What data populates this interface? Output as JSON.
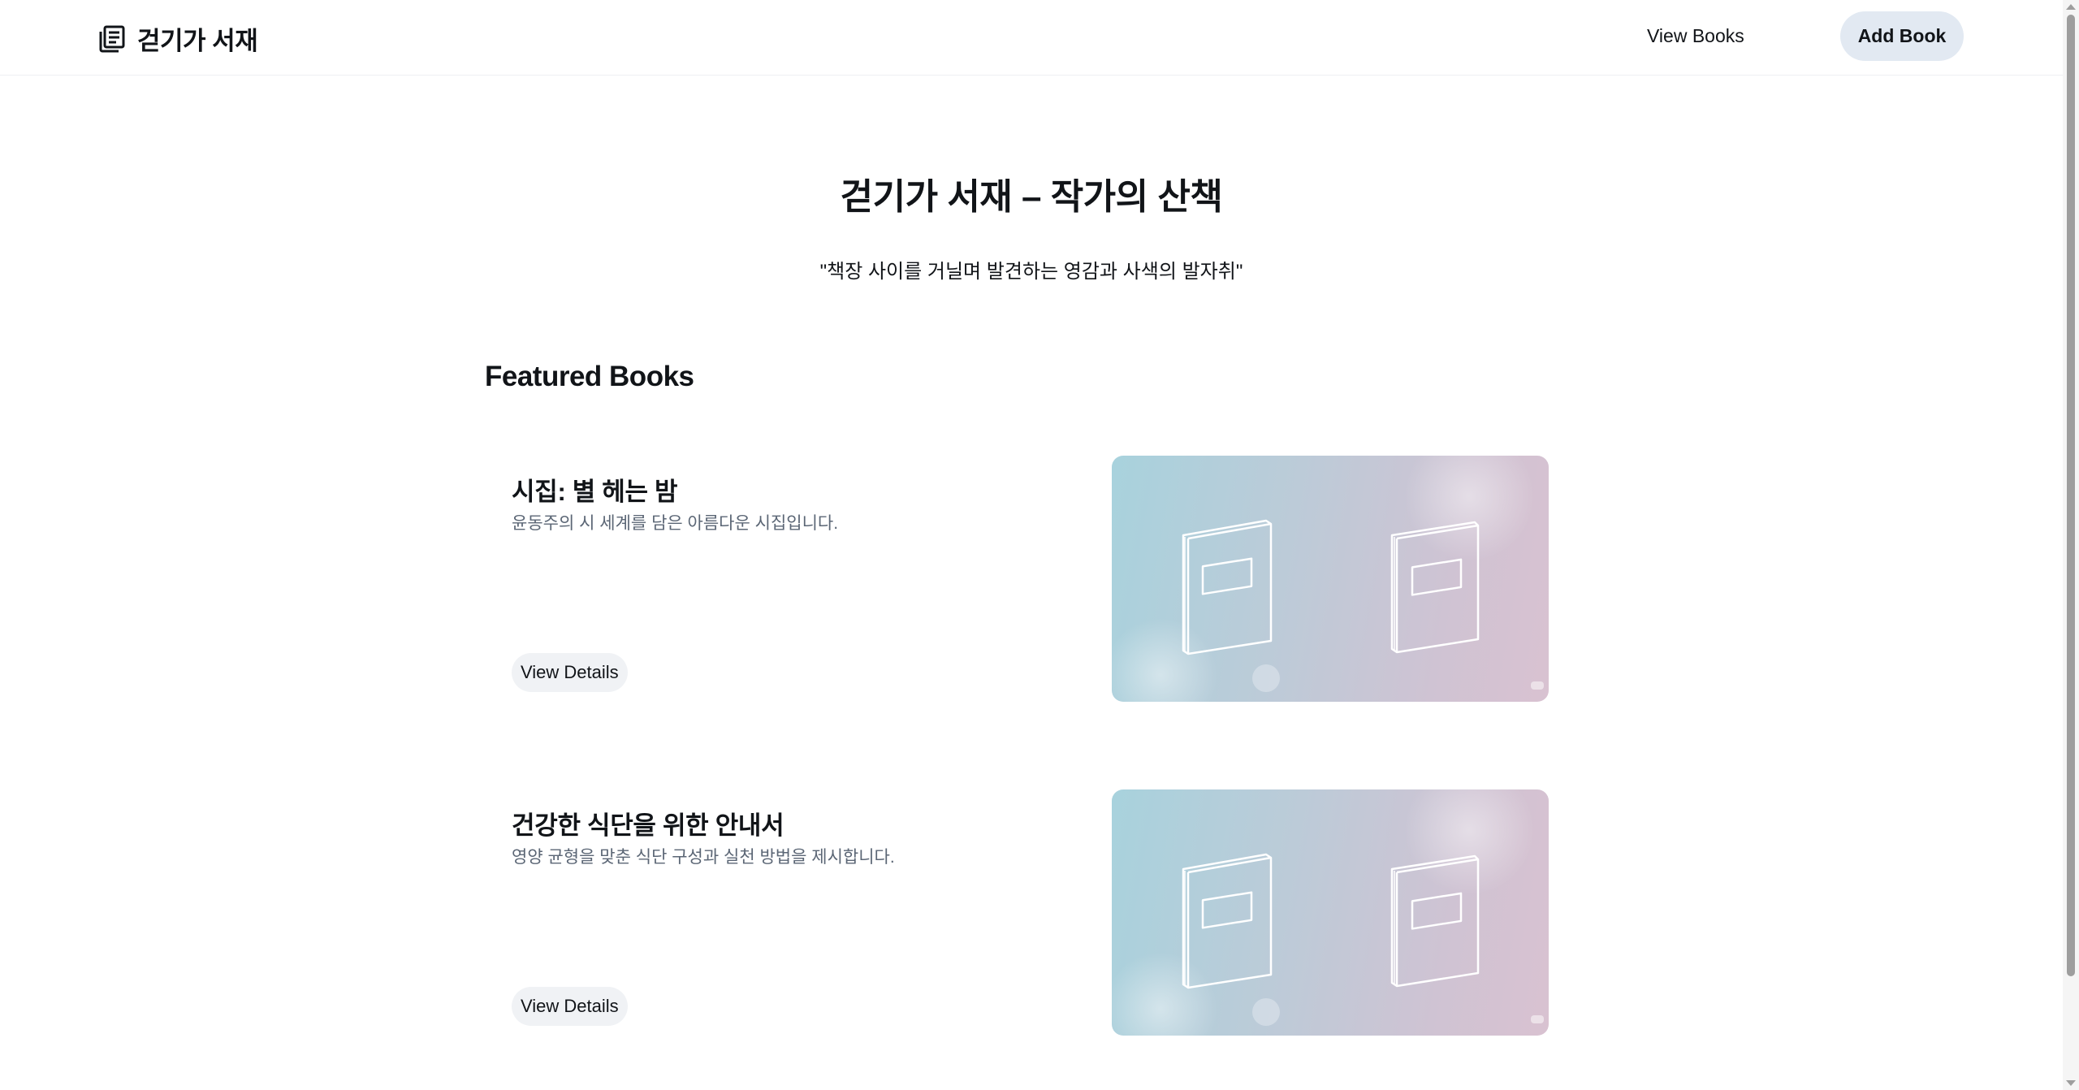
{
  "header": {
    "brand_icon": "book-library-icon",
    "brand_name": "걷기가 서재",
    "nav_view_books": "View Books",
    "nav_add_book": "Add Book"
  },
  "hero": {
    "title": "걷기가 서재 – 작가의 산책",
    "quote": "\"책장 사이를 거닐며 발견하는 영감과 사색의 발자취\""
  },
  "featured": {
    "section_title": "Featured Books",
    "books": [
      {
        "title": "시집: 별 헤는 밤",
        "description": "윤동주의 시 세계를 담은 아름다운 시집입니다.",
        "button": "View Details",
        "cover_icon": "book-illustration-icon"
      },
      {
        "title": "건강한 식단을 위한 안내서",
        "description": "영양 균형을 맞춘 식단 구성과 실천 방법을 제시합니다.",
        "button": "View Details",
        "cover_icon": "book-illustration-icon"
      }
    ]
  },
  "colors": {
    "add_button_bg": "#e2e9f2",
    "details_button_bg": "#f0f2f5",
    "description_text": "#5b6675",
    "cover_gradient_start": "#a8d2dd",
    "cover_gradient_end": "#d9c2d1"
  }
}
